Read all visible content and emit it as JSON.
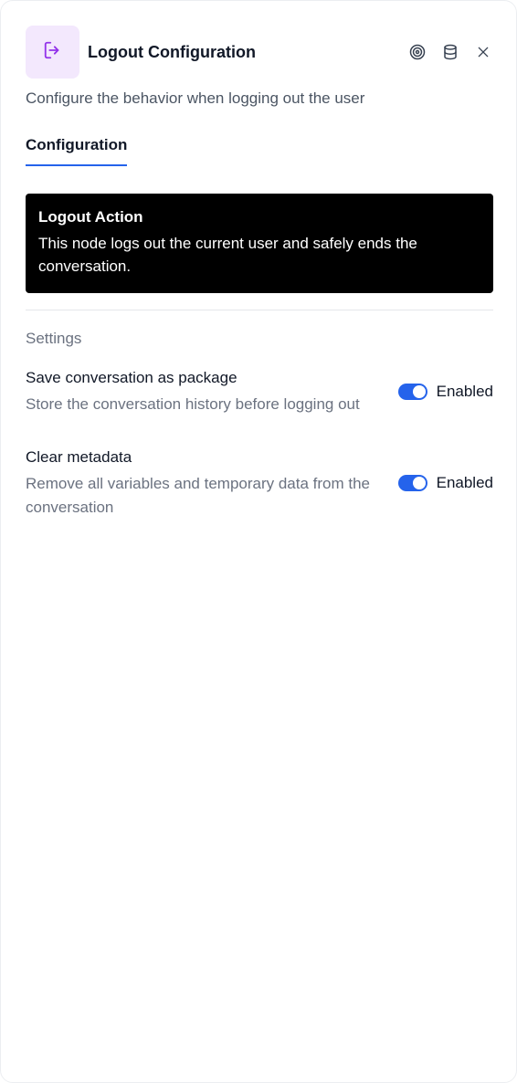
{
  "header": {
    "title": "Logout Configuration",
    "node_icon": "logout-icon",
    "actions": [
      "target-icon",
      "database-icon",
      "close-icon"
    ]
  },
  "subtitle": "Configure the behavior when logging out the user",
  "tabs": [
    {
      "label": "Configuration",
      "active": true
    }
  ],
  "info": {
    "title": "Logout Action",
    "text": "This node logs out the current user and safely ends the conversation."
  },
  "settings_section": {
    "label": "Settings",
    "items": [
      {
        "name": "Save conversation as package",
        "description": "Store the conversation history before logging out",
        "enabled": true,
        "state_label": "Enabled"
      },
      {
        "name": "Clear metadata",
        "description": "Remove all variables and temporary data from the conversation",
        "enabled": true,
        "state_label": "Enabled"
      }
    ]
  },
  "colors": {
    "accent": "#2563eb",
    "icon_bg": "#f3e8fd",
    "icon_fg": "#9333ea",
    "info_bg": "#000000"
  }
}
